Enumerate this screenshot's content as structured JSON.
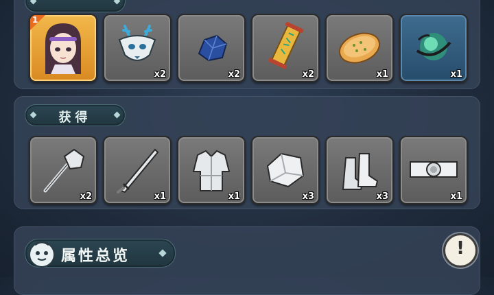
{
  "sections": {
    "top": {
      "title": "",
      "items": [
        {
          "name": "hero-avatar",
          "icon": "purple-haired-hero-portrait",
          "count": "",
          "badge": "1"
        },
        {
          "name": "deer-mask",
          "icon": "blue-deer-mask-icon",
          "count": "x2"
        },
        {
          "name": "blue-ore",
          "icon": "blue-ore-icon",
          "count": "x2"
        },
        {
          "name": "talisman-scroll",
          "icon": "talisman-scroll-icon",
          "count": "x2"
        },
        {
          "name": "flatbread",
          "icon": "flatbread-icon",
          "count": "x1"
        },
        {
          "name": "spirit-orb",
          "icon": "green-spirit-orb-icon",
          "count": "x1"
        }
      ]
    },
    "obtained": {
      "title": "获得",
      "items": [
        {
          "name": "mace",
          "icon": "mace-icon",
          "count": "x2"
        },
        {
          "name": "sword",
          "icon": "sword-icon",
          "count": "x1"
        },
        {
          "name": "robe",
          "icon": "robe-icon",
          "count": "x1"
        },
        {
          "name": "bracer",
          "icon": "bracer-icon",
          "count": "x3"
        },
        {
          "name": "boots",
          "icon": "boots-icon",
          "count": "x3"
        },
        {
          "name": "belt",
          "icon": "belt-icon",
          "count": "x1"
        }
      ]
    }
  },
  "overview": {
    "title": "属性总览",
    "icon": "attribute-mascot-icon"
  },
  "info_button": {
    "label": "!"
  },
  "colors": {
    "gold_slot": "#e9a43a",
    "blue_slot": "#31597a",
    "gray_slot": "#6b6b6b",
    "panel": "#344256"
  }
}
